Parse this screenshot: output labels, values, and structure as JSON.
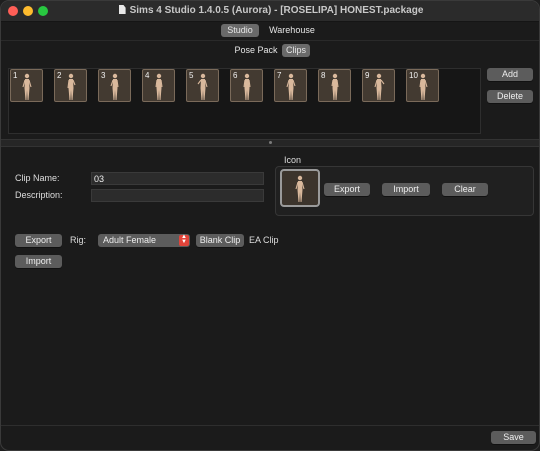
{
  "window": {
    "title": "Sims 4 Studio 1.4.0.5 (Aurora)  - [ROSELIPA] HONEST.package"
  },
  "top_tabs": [
    {
      "label": "Studio",
      "active": true
    },
    {
      "label": "Warehouse",
      "active": false
    }
  ],
  "sub_tabs": [
    {
      "label": "Pose Pack",
      "active": false
    },
    {
      "label": "Clips",
      "active": true
    }
  ],
  "clips": [
    {
      "num": "1"
    },
    {
      "num": "2"
    },
    {
      "num": "3"
    },
    {
      "num": "4"
    },
    {
      "num": "5"
    },
    {
      "num": "6"
    },
    {
      "num": "7"
    },
    {
      "num": "8"
    },
    {
      "num": "9"
    },
    {
      "num": "10"
    }
  ],
  "clip_actions": {
    "add": "Add",
    "delete": "Delete"
  },
  "form": {
    "clip_name_label": "Clip Name:",
    "clip_name_value": "03",
    "description_label": "Description:",
    "description_value": ""
  },
  "icon_panel": {
    "title": "Icon",
    "export": "Export",
    "import": "Import",
    "clear": "Clear"
  },
  "rig_row": {
    "export": "Export",
    "rig_label": "Rig:",
    "rig_value": "Adult Female",
    "blank_clip": "Blank Clip",
    "ea_clip": "EA Clip",
    "import": "Import"
  },
  "footer": {
    "save": "Save"
  },
  "colors": {
    "accent_stepper": "#e0443a",
    "thumb_bg": "#433a31"
  }
}
